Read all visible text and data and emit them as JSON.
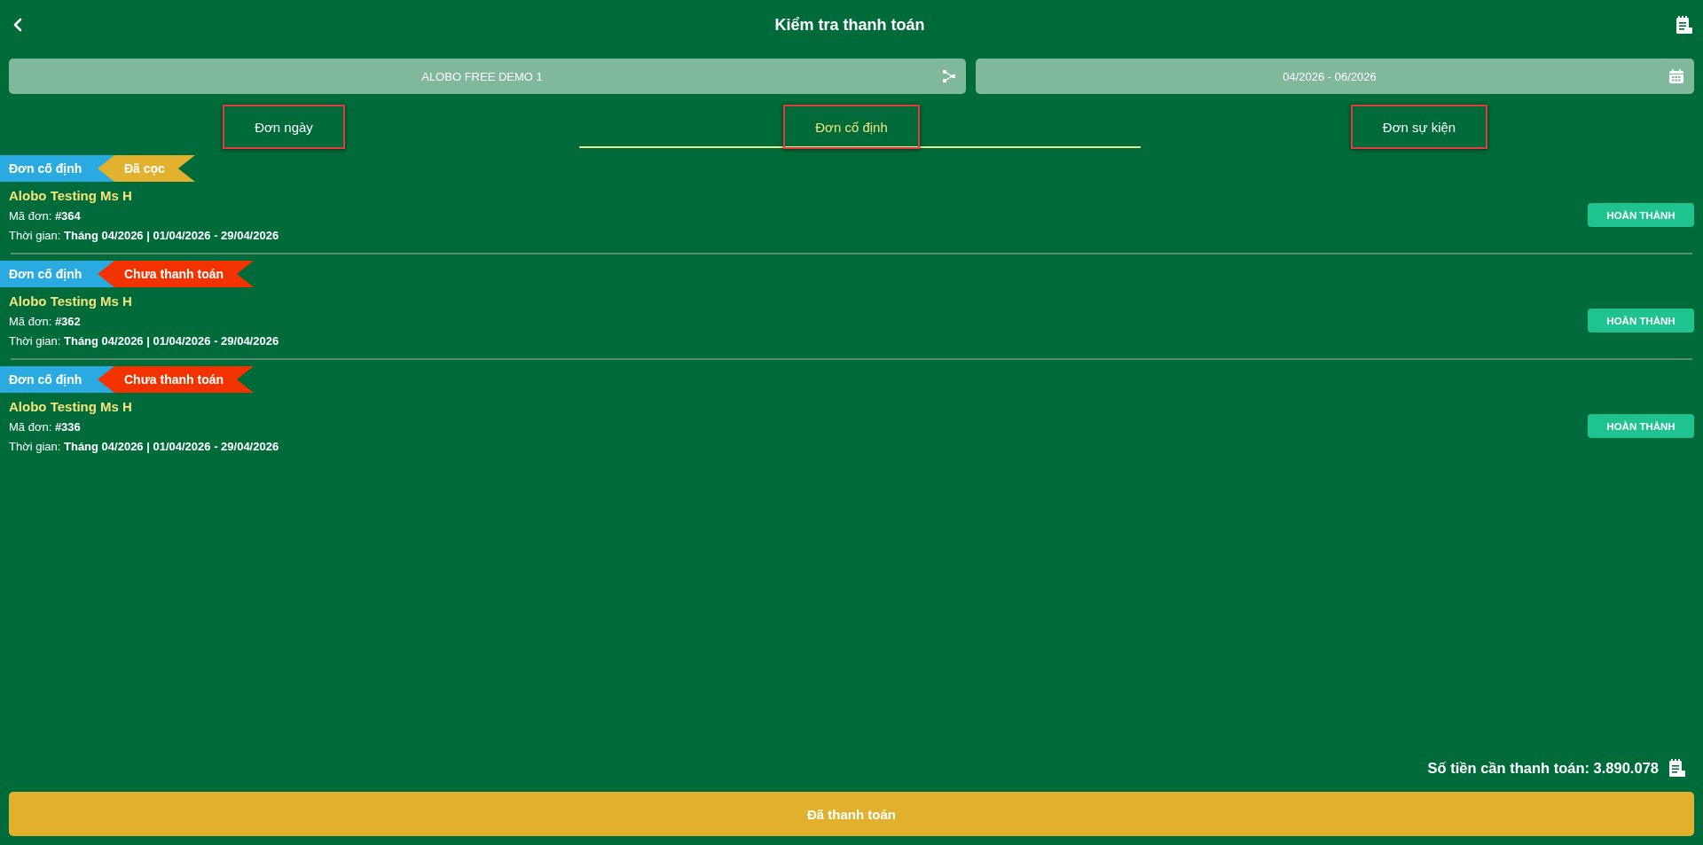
{
  "header": {
    "title": "Kiểm tra thanh toán"
  },
  "filters": [
    {
      "kind": "select",
      "value": "ALOBO FREE DEMO 1"
    },
    {
      "kind": "date_range",
      "value": "04/2026 - 06/2026"
    }
  ],
  "tabs": [
    {
      "label": "Đơn ngày",
      "selected": false,
      "highlighted": true
    },
    {
      "label": "Đơn cố định",
      "selected": true,
      "highlighted": true
    },
    {
      "label": "Đơn sự kiện",
      "selected": false,
      "highlighted": true
    }
  ],
  "orders": [
    {
      "type_label": "Đơn cố định",
      "status": {
        "label": "Đã cọc",
        "color": "#e2b12d"
      },
      "customer": "Alobo Testing Ms H",
      "code": "Mã đơn: **#364**",
      "time": "Thời gian: **Tháng 04/2026 | 01/04/2026 - 29/04/2026**",
      "action": "HOÀN THÀNH"
    },
    {
      "type_label": "Đơn cố định",
      "status": {
        "label": "Chưa thanh toán",
        "color": "#f23300"
      },
      "customer": "Alobo Testing Ms H",
      "code": "Mã đơn: **#362**",
      "time": "Thời gian: **Tháng 04/2026 | 01/04/2026 - 29/04/2026**",
      "action": "HOÀN THÀNH"
    },
    {
      "type_label": "Đơn cố định",
      "status": {
        "label": "Chưa thanh toán",
        "color": "#f23300"
      },
      "customer": "Alobo Testing Ms H",
      "code": "Mã đơn: **#336**",
      "time": "Thời gian: **Tháng 04/2026 | 01/04/2026 - 29/04/2026**",
      "action": "HOÀN THÀNH"
    }
  ],
  "summary": {
    "total": "Số tiền cần thanh toán: 3.890.078"
  },
  "submit_button": "Đã thanh toán"
}
